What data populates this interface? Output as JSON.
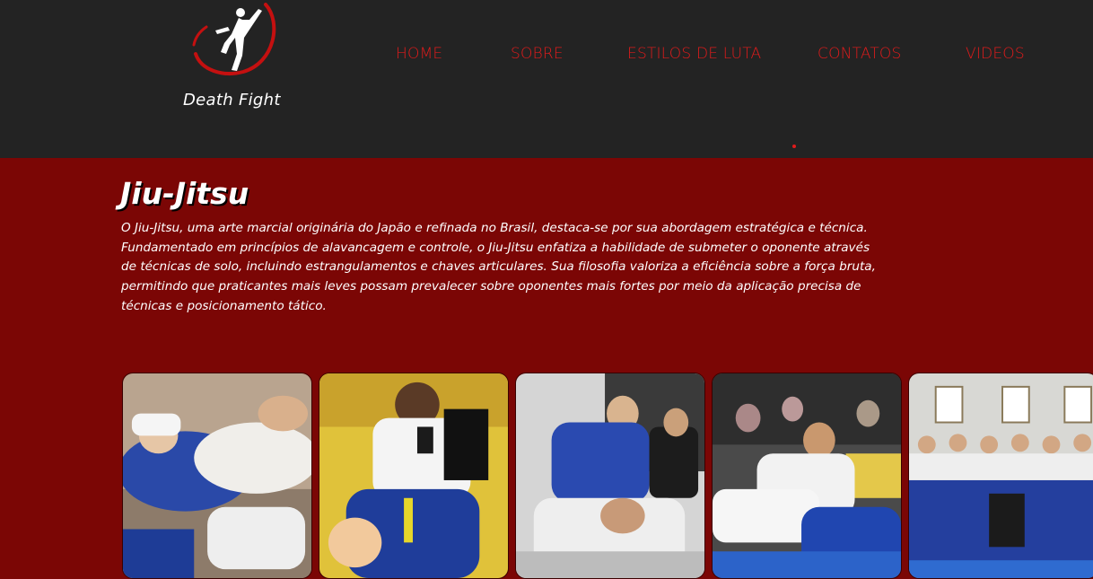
{
  "brand": {
    "name": "Death Fight",
    "accent": "#e01b1b"
  },
  "nav": {
    "items": [
      {
        "label": "HOME"
      },
      {
        "label": "SOBRE"
      },
      {
        "label": "ESTILOS DE LUTA"
      },
      {
        "label": "CONTATOS"
      },
      {
        "label": "VIDEOS"
      }
    ]
  },
  "section": {
    "title": "Jiu-Jitsu",
    "description": "O Jiu-Jitsu, uma arte marcial originária do Japão e refinada no Brasil, destaca-se por sua abordagem estratégica e técnica. Fundamentado em princípios de alavancagem e controle, o Jiu-Jitsu enfatiza a habilidade de submeter o oponente através de técnicas de solo, incluindo estrangulamentos e chaves articulares. Sua filosofia valoriza a eficiência sobre a força bruta, permitindo que praticantes mais leves possam prevalecer sobre oponentes mais fortes por meio da aplicação precisa de técnicas e posicionamento tático."
  },
  "gallery": {
    "images": [
      {
        "icon": "jiu-jitsu-photo-ground-fight"
      },
      {
        "icon": "jiu-jitsu-photo-kids-match"
      },
      {
        "icon": "jiu-jitsu-photo-training"
      },
      {
        "icon": "jiu-jitsu-photo-competition"
      },
      {
        "icon": "jiu-jitsu-photo-team-group"
      }
    ]
  },
  "colors": {
    "header_bg": "#232323",
    "content_bg": "#7b0605",
    "gi_blue": "#1f3f9e",
    "gi_white": "#f2f2f2"
  }
}
